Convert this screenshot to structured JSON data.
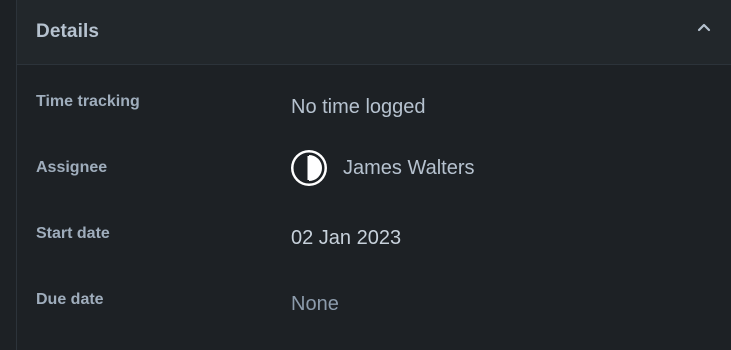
{
  "panel": {
    "title": "Details",
    "collapse_icon": "chevron-up-icon"
  },
  "fields": {
    "time_tracking": {
      "label": "Time tracking",
      "value": "No time logged"
    },
    "assignee": {
      "label": "Assignee",
      "value": "James Walters",
      "avatar_icon": "user-avatar-icon"
    },
    "start_date": {
      "label": "Start date",
      "value": "02 Jan 2023"
    },
    "due_date": {
      "label": "Due date",
      "value": "None"
    }
  },
  "colors": {
    "background": "#1d2125",
    "header_background": "#22272b",
    "label_text": "#9fadbc",
    "value_text": "#b6c2cf"
  }
}
